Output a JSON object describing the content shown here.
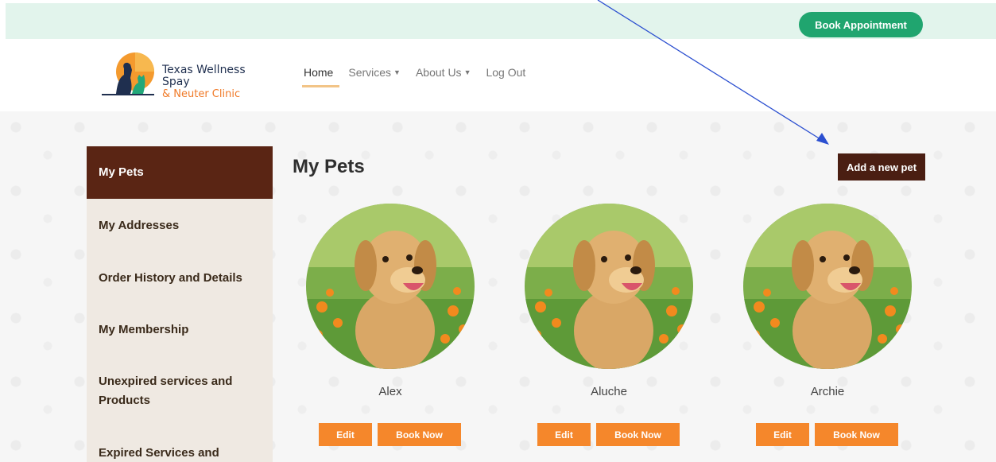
{
  "topbar": {
    "book_label": "Book Appointment"
  },
  "logo": {
    "line1": "Texas Wellness Spay",
    "line2": "& Neuter Clinic"
  },
  "nav": {
    "items": [
      {
        "label": "Home",
        "active": true
      },
      {
        "label": "Services",
        "dropdown": true
      },
      {
        "label": "About Us",
        "dropdown": true
      },
      {
        "label": "Log Out"
      }
    ]
  },
  "sidebar": {
    "items": [
      {
        "label": "My Pets",
        "active": true
      },
      {
        "label": "My Addresses"
      },
      {
        "label": "Order History and Details"
      },
      {
        "label": "My Membership"
      },
      {
        "label": "Unexpired services and Products"
      },
      {
        "label": "Expired Services and"
      }
    ]
  },
  "main": {
    "title": "My Pets",
    "add_pet_label": "Add a new pet",
    "pets": [
      {
        "name": "Alex",
        "edit_label": "Edit",
        "book_label": "Book Now"
      },
      {
        "name": "Aluche",
        "edit_label": "Edit",
        "book_label": "Book Now"
      },
      {
        "name": "Archie",
        "edit_label": "Edit",
        "book_label": "Book Now"
      }
    ]
  },
  "colors": {
    "topbar_bg": "#e2f4ec",
    "brand_green": "#20a56f",
    "sidebar_active": "#5a2514",
    "add_pet_bg": "#4a1e12",
    "orange": "#f5872b",
    "annotation_arrow": "#2b4fd0"
  }
}
